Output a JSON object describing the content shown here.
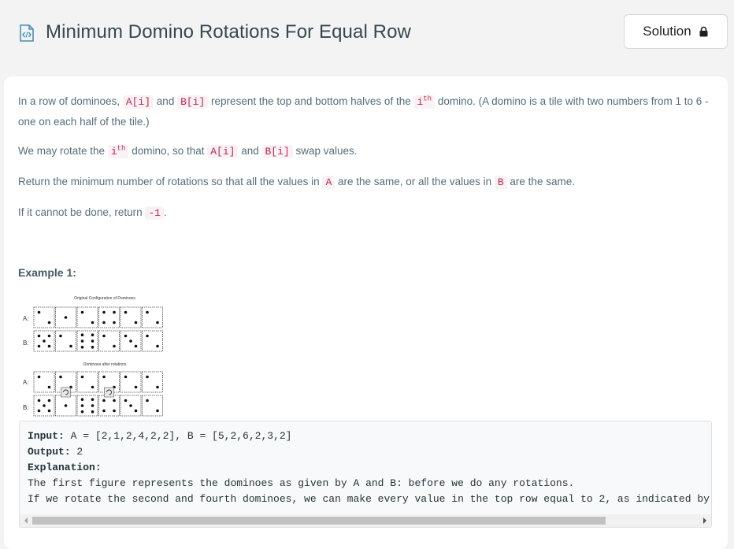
{
  "header": {
    "title": "Minimum Domino Rotations For Equal Row",
    "solution_label": "Solution"
  },
  "description": {
    "p1": {
      "t1": "In a row of dominoes, ",
      "c1": "A[i]",
      "t2": " and ",
      "c2": "B[i]",
      "t3": " represent the top and bottom halves of the ",
      "c3": "i",
      "sup": "th",
      "t4": " domino.  (A domino is a tile with two numbers from 1 to 6 - one on each half of the tile.)"
    },
    "p2": {
      "t1": "We may rotate the ",
      "c1": "i",
      "sup": "th",
      "t2": " domino, so that ",
      "c2": "A[i]",
      "t3": " and ",
      "c3": "B[i]",
      "t4": " swap values."
    },
    "p3": {
      "t1": "Return the minimum number of rotations so that all the values in ",
      "c1": "A",
      "t2": " are the same, or all the values in ",
      "c2": "B",
      "t3": " are the same."
    },
    "p4": {
      "t1": "If it cannot be done, return ",
      "c1": "-1",
      "t2": "."
    }
  },
  "example": {
    "title": "Example 1:",
    "figure": {
      "caption_top": "Original Configuration of Dominoes",
      "caption_bottom": "Dominoes after rotations",
      "row_a": "A:",
      "row_b": "B:",
      "original_a": [
        2,
        1,
        2,
        4,
        2,
        2
      ],
      "original_b": [
        5,
        2,
        6,
        2,
        3,
        2
      ],
      "rotated_a": [
        2,
        2,
        2,
        2,
        2,
        2
      ],
      "rotated_b": [
        5,
        1,
        6,
        4,
        3,
        2
      ]
    },
    "input_label": "Input:",
    "input_value": " A = [2,1,2,4,2,2], B = [5,2,6,2,3,2]",
    "output_label": "Output:",
    "output_value": " 2",
    "explanation_label": "Explanation:",
    "explanation_line1": "The first figure represents the dominoes as given by A and B: before we do any rotations.",
    "explanation_line2": "If we rotate the second and fourth dominoes, we can make every value in the top row equal to 2, as indicated by t"
  },
  "icons": {
    "title_icon": "code-file-icon",
    "lock_icon": "lock-icon",
    "rotate_icon": "rotate-icon"
  },
  "colors": {
    "code_text": "#c7254e",
    "code_bg": "#f9f2f4",
    "icon_blue": "#4a90b8"
  }
}
